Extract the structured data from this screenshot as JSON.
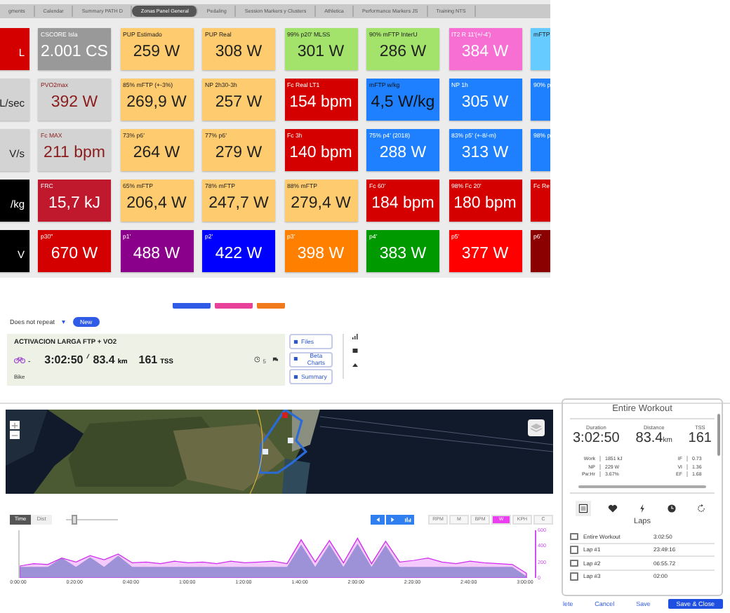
{
  "tabs": [
    {
      "label": "gments",
      "selected": false
    },
    {
      "label": "Calendar",
      "selected": false
    },
    {
      "label": "Summary PATH D",
      "selected": false
    },
    {
      "label": "Zonas Panel General",
      "selected": true
    },
    {
      "label": "Pedaling",
      "selected": false
    },
    {
      "label": "Session Markers y Clusters",
      "selected": false
    },
    {
      "label": "Athletica",
      "selected": false
    },
    {
      "label": "Performance Markers JS",
      "selected": false
    },
    {
      "label": "Training NTS",
      "selected": false
    }
  ],
  "tiles": [
    [
      {
        "value": "L",
        "color": "#d40000"
      },
      {
        "label": "CSCORE Isla",
        "value": "2.001 CS",
        "color": "#999999"
      },
      {
        "label": "PUP Estimado",
        "value": "259 W",
        "color": "#fecb6e"
      },
      {
        "label": "PUP Real",
        "value": "308 W",
        "color": "#fecb6e"
      },
      {
        "label": "99% p20' MLSS",
        "value": "301 W",
        "color": "#a3e26b"
      },
      {
        "label": "90% mFTP InterU",
        "value": "286 W",
        "color": "#a3e26b"
      },
      {
        "label": "IT2 R 11'(+/-4')",
        "value": "384 W",
        "color": "#f76fd2"
      },
      {
        "label": "mFTP",
        "color": "#66ccff"
      }
    ],
    [
      {
        "value": "L/sec",
        "color": "#d3d3d3"
      },
      {
        "label": "PVO2max",
        "value": "392 W",
        "color": "#d3d3d3"
      },
      {
        "label": "85% mFTP (+-3%)",
        "value": "269,9 W",
        "color": "#fecb6e"
      },
      {
        "label": "NP 2h30-3h",
        "value": "257 W",
        "color": "#fecb6e"
      },
      {
        "label": "Fc Real LT1",
        "value": "154 bpm",
        "color": "#d40000"
      },
      {
        "label": "mFTP w/kg",
        "value": "4,5 W/kg",
        "color": "#1e80ff"
      },
      {
        "label": "NP 1h",
        "value": "305 W",
        "color": "#1e80ff"
      },
      {
        "label": "90% p",
        "color": "#1e80ff"
      }
    ],
    [
      {
        "value": "V/s",
        "color": "#d3d3d3"
      },
      {
        "label": "Fc MAX",
        "value": "211 bpm",
        "color": "#d3d3d3"
      },
      {
        "label": "73% p6'",
        "value": "264 W",
        "color": "#fecb6e"
      },
      {
        "label": "77% p6'",
        "value": "279 W",
        "color": "#fecb6e"
      },
      {
        "label": "Fc 3h",
        "value": "140 bpm",
        "color": "#d40000"
      },
      {
        "label": "75% p4' (2018)",
        "value": "288 W",
        "color": "#1e80ff"
      },
      {
        "label": "83% p5' (+-8/-m)",
        "value": "313 W",
        "color": "#1e80ff"
      },
      {
        "label": "98% p",
        "color": "#1e80ff"
      }
    ],
    [
      {
        "value": "/kg",
        "color": "#000000"
      },
      {
        "label": "FRC",
        "value": "15,7 kJ",
        "color": "#c0182c"
      },
      {
        "label": "65% mFTP",
        "value": "206,4 W",
        "color": "#fecb6e"
      },
      {
        "label": "78% mFTP",
        "value": "247,7 W",
        "color": "#fecb6e"
      },
      {
        "label": "88% mFTP",
        "value": "279,4 W",
        "color": "#fecb6e"
      },
      {
        "label": "Fc 60'",
        "value": "184 bpm",
        "color": "#d40000"
      },
      {
        "label": "98% Fc 20'",
        "value": "180 bpm",
        "color": "#d40000"
      },
      {
        "label": "Fc Re",
        "color": "#d40000"
      }
    ],
    [
      {
        "value": "V",
        "color": "#000000"
      },
      {
        "label": "p30\"",
        "value": "670 W",
        "color": "#d40000"
      },
      {
        "label": "p1'",
        "value": "488 W",
        "color": "#8b008b"
      },
      {
        "label": "p2'",
        "value": "422 W",
        "color": "#0000ff"
      },
      {
        "label": "p3'",
        "value": "398 W",
        "color": "#ff8000"
      },
      {
        "label": "p4'",
        "value": "383 W",
        "color": "#009900"
      },
      {
        "label": "p5'",
        "value": "377 W",
        "color": "#ff0000"
      },
      {
        "label": "p6'",
        "color": "#8b0000"
      }
    ]
  ],
  "repeat": {
    "value": "Does not repeat",
    "caret": "▾",
    "new_button": "New"
  },
  "workout": {
    "title": "ACTIVACION LARGA FTP + VO2",
    "sport_caret": "-",
    "duration": "3:02:50",
    "distance": "83.4",
    "distance_unit": "km",
    "tss": "161",
    "tss_unit": "TSS",
    "comments": "5",
    "sport": "Bike",
    "buttons": [
      "Files",
      "Beta Charts",
      "Summary"
    ]
  },
  "chart_controls": {
    "modes": [
      {
        "label": "Time",
        "selected": true
      },
      {
        "label": "Dist",
        "selected": false
      }
    ],
    "zoom_slider": {
      "level": 0.1
    },
    "channels": [
      {
        "label": "RPM",
        "selected": false
      },
      {
        "label": "M",
        "selected": false
      },
      {
        "label": "BPM",
        "selected": false
      },
      {
        "label": "W",
        "selected": true
      },
      {
        "label": "KPH",
        "selected": false
      },
      {
        "label": "C",
        "selected": false
      }
    ]
  },
  "power_chart": {
    "chart_data": {
      "type": "area",
      "x": [
        0,
        5,
        10,
        15,
        20,
        25,
        30,
        35,
        40,
        45,
        50,
        55,
        60,
        65,
        70,
        75,
        80,
        85,
        90,
        95,
        100,
        105,
        110,
        115,
        120,
        125,
        130,
        135,
        140,
        145,
        150,
        155,
        160,
        165,
        170,
        175,
        180
      ],
      "series": [
        {
          "color": "#8db3cf",
          "values": [
            140,
            140,
            140,
            250,
            140,
            260,
            140,
            280,
            140,
            140,
            140,
            140,
            140,
            140,
            140,
            140,
            140,
            140,
            140,
            140,
            420,
            140,
            420,
            140,
            430,
            140,
            410,
            140,
            140,
            140,
            140,
            140,
            140,
            140,
            140,
            140,
            20
          ]
        },
        {
          "color": "#d02cf0",
          "values": [
            150,
            180,
            170,
            250,
            200,
            280,
            230,
            300,
            190,
            200,
            180,
            210,
            190,
            200,
            180,
            210,
            190,
            200,
            210,
            180,
            480,
            200,
            470,
            190,
            500,
            180,
            460,
            200,
            220,
            250,
            200,
            180,
            210,
            190,
            180,
            170,
            60
          ]
        }
      ],
      "xlim": [
        0,
        183
      ],
      "ylim": [
        0,
        600
      ],
      "xticks": [
        {
          "value": 0,
          "label": "0:00:00"
        },
        {
          "value": 20,
          "label": "0:20:00"
        },
        {
          "value": 40,
          "label": "0:40:00"
        },
        {
          "value": 60,
          "label": "1:00:00"
        },
        {
          "value": 80,
          "label": "1:20:00"
        },
        {
          "value": 100,
          "label": "1:40:00"
        },
        {
          "value": 120,
          "label": "2:00:00"
        },
        {
          "value": 140,
          "label": "2:20:00"
        },
        {
          "value": 160,
          "label": "2:40:00"
        },
        {
          "value": 180,
          "label": "3:00:00"
        }
      ],
      "yticks": [
        0,
        200,
        400,
        600
      ]
    }
  },
  "summary": {
    "title": "Entire Workout",
    "headline": [
      {
        "label": "Duration",
        "value": "3:02:50"
      },
      {
        "label": "Distance",
        "value": "83.4",
        "unit": "km"
      },
      {
        "label": "TSS",
        "value": "161"
      }
    ],
    "stats": [
      {
        "label": "Work",
        "value": "1851 kJ",
        "label2": "IF",
        "value2": "0.73"
      },
      {
        "label": "NP",
        "value": "229 W",
        "label2": "VI",
        "value2": "1.36"
      },
      {
        "label": "Pw:Hr",
        "value": "3.67%",
        "label2": "EF",
        "value2": "1.68"
      }
    ],
    "laps_title": "Laps",
    "laps": [
      {
        "name": "Entire Workout",
        "time": "3:02:50",
        "checked": false
      },
      {
        "name": "Lap #1",
        "time": "23:49:16",
        "checked": false
      },
      {
        "name": "Lap #2",
        "time": "06:55.72",
        "checked": false
      },
      {
        "name": "Lap #3",
        "time": "02:00",
        "checked": false
      }
    ]
  },
  "footer_buttons": [
    {
      "label": "lete",
      "kind": "link"
    },
    {
      "label": "Cancel",
      "kind": "link"
    },
    {
      "label": "Save",
      "kind": "link"
    },
    {
      "label": "Save & Close",
      "kind": "primary"
    }
  ]
}
